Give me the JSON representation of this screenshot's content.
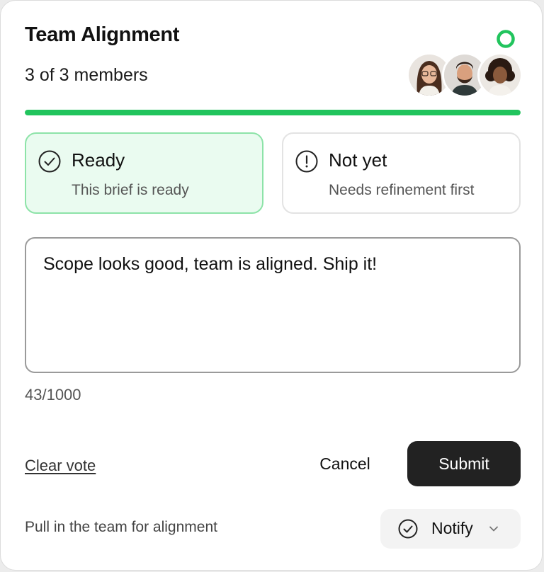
{
  "card": {
    "title": "Team Alignment",
    "members_text": "3 of 3 members",
    "status_color": "#21c45d",
    "avatars": [
      {
        "name": "avatar-woman-glasses"
      },
      {
        "name": "avatar-man-beard"
      },
      {
        "name": "avatar-woman-curly"
      }
    ],
    "progress": 1.0,
    "progress_color": "#21c45d"
  },
  "options": {
    "ready": {
      "title": "Ready",
      "subtitle": "This brief is ready",
      "icon": "check-circle-icon",
      "selected": true
    },
    "not_yet": {
      "title": "Not yet",
      "subtitle": "Needs refinement first",
      "icon": "exclamation-circle-icon",
      "selected": false
    }
  },
  "comment": {
    "value": "Scope looks good, team is aligned. Ship it!",
    "counter": "43/1000"
  },
  "actions": {
    "clear_label": "Clear vote",
    "cancel_label": "Cancel",
    "submit_label": "Submit"
  },
  "footer": {
    "text": "Pull in the team for alignment",
    "notify_label": "Notify",
    "notify_icon": "check-circle-icon",
    "dropdown_icon": "chevron-down-icon"
  }
}
